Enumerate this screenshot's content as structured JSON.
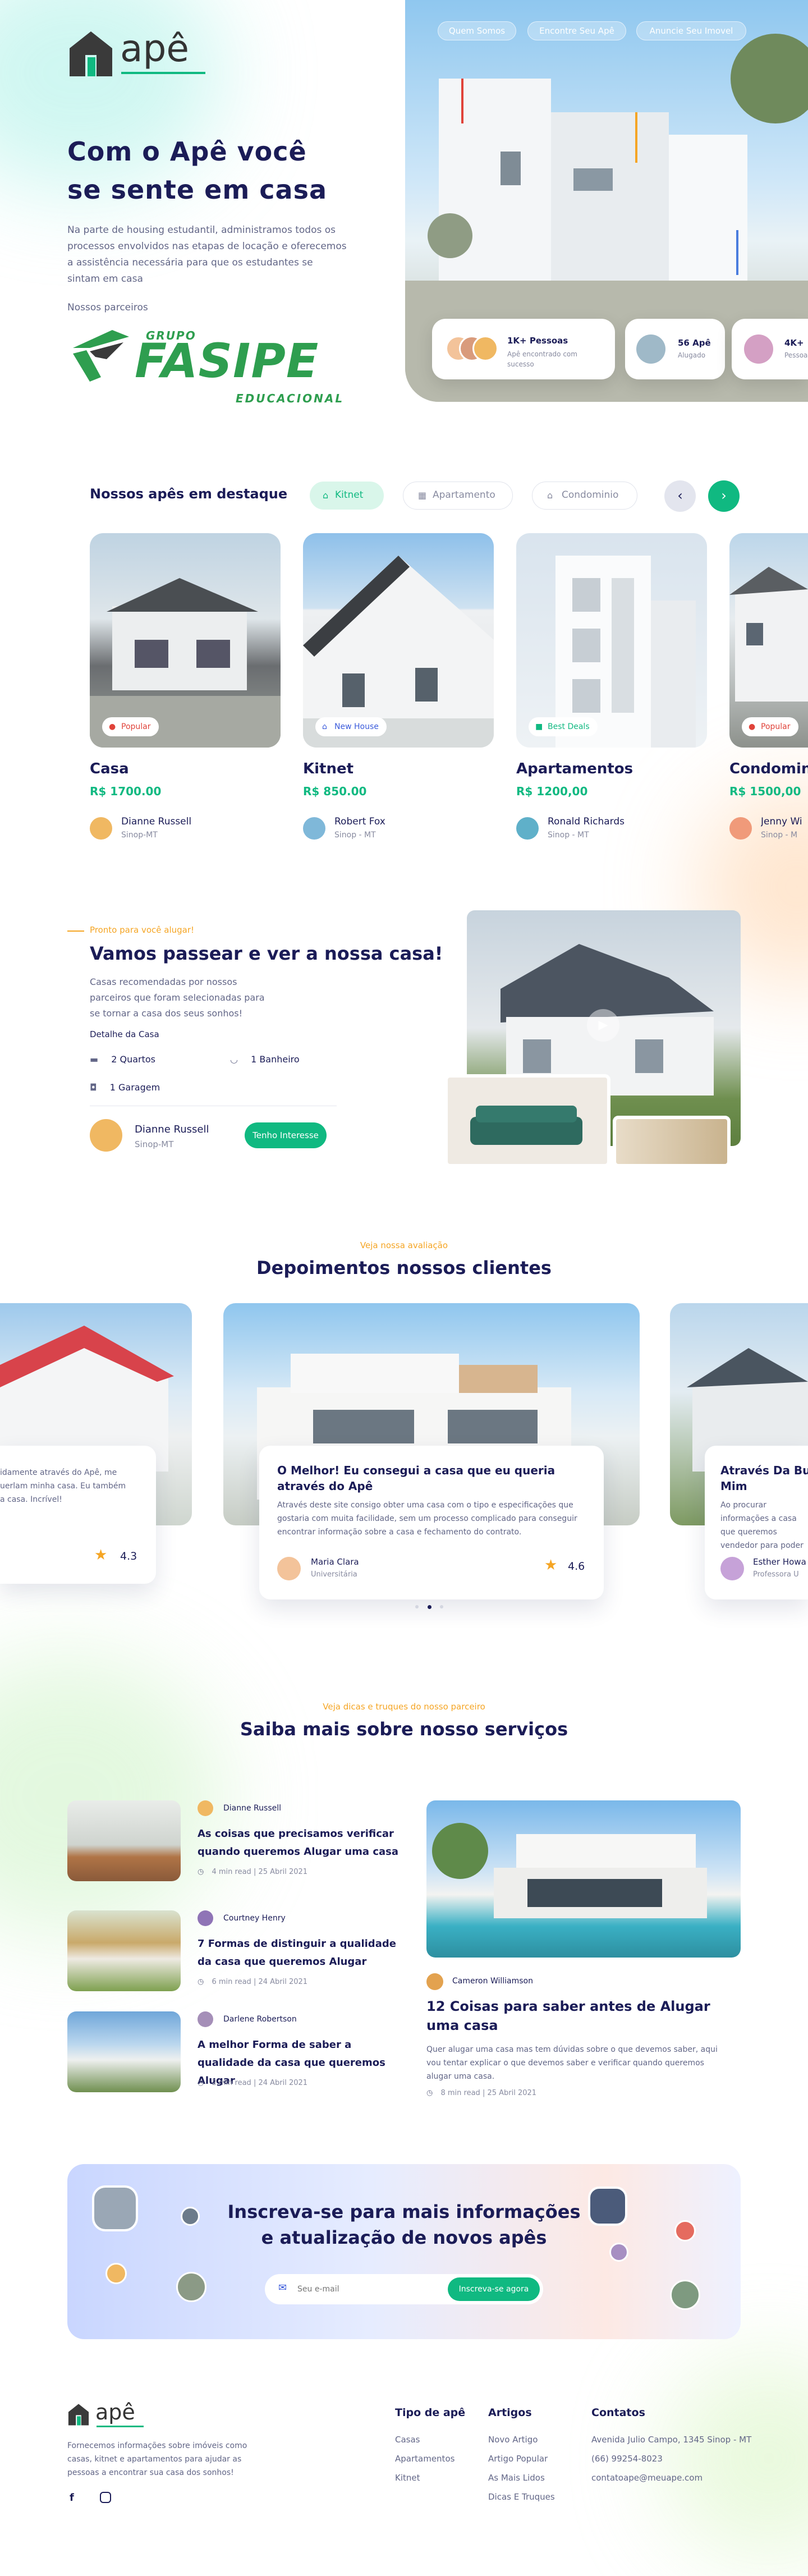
{
  "brand": {
    "name": "apê"
  },
  "nav": [
    "Quem Somos",
    "Encontre Seu Apê",
    "Anuncie Seu Imovel"
  ],
  "hero": {
    "title_line1": "Com o Apê você",
    "title_line2": "se sente em casa",
    "description": "Na parte de housing estudantil, administramos todos os processos envolvidos nas etapas de locação e oferecemos a assistência necessária para que os estudantes se sintam em casa",
    "partners_label": "Nossos parceiros",
    "partner_logo": {
      "top": "GRUPO",
      "main": "FASIPE",
      "bottom": "EDUCACIONAL"
    },
    "stats": [
      {
        "title": "1K+ Pessoas",
        "subtitle": "Apê encontrado com sucesso"
      },
      {
        "title": "56 Apê",
        "subtitle": "Alugado"
      },
      {
        "title": "4K+",
        "subtitle": "Pessoas"
      }
    ]
  },
  "featured": {
    "title": "Nossos apês em destaque",
    "tabs": [
      "Kitnet",
      "Apartamento",
      "Condominio"
    ],
    "cards": [
      {
        "badge": "Popular",
        "title": "Casa",
        "price": "R$ 1700.00",
        "owner": "Dianne Russell",
        "location": "Sinop-MT"
      },
      {
        "badge": "New House",
        "title": "Kitnet",
        "price": "R$ 850.00",
        "owner": "Robert Fox",
        "location": "Sinop - MT"
      },
      {
        "badge": "Best Deals",
        "title": "Apartamentos",
        "price": "R$ 1200,00",
        "owner": "Ronald Richards",
        "location": "Sinop - MT"
      },
      {
        "badge": "Popular",
        "title": "Condominio",
        "price": "R$ 1500,00",
        "owner": "Jenny Wi",
        "location": "Sinop - M"
      }
    ]
  },
  "visit": {
    "eyebrow": "Pronto para você alugar!",
    "title": "Vamos passear e ver a nossa casa!",
    "description": "Casas recomendadas por nossos parceiros que foram selecionadas para se tornar a casa dos seus sonhos!",
    "details_label": "Detalhe da Casa",
    "details": [
      "2 Quartos",
      "1 Banheiro",
      "1 Garagem"
    ],
    "agent_name": "Dianne Russell",
    "agent_location": "Sinop-MT",
    "cta": "Tenho Interesse"
  },
  "reviews": {
    "eyebrow": "Veja nossa avaliação",
    "title": "Depoimentos nossos clientes",
    "left_text": "idamente através do Apê, me uerlam minha casa. Eu também a casa. Incrível!",
    "left_rating": "4.3",
    "main": {
      "title": "O Melhor! Eu consegui a casa que eu queria através do Apê",
      "text": "Através deste site consigo obter uma casa com o tipo e especificações que gostaria com muita facilidade, sem um processo complicado para conseguir encontrar informação sobre a casa e fechamento do contrato.",
      "name": "Maria Clara",
      "role": "Universitária",
      "rating": "4.6"
    },
    "right": {
      "title": "Através Da Bus Mim",
      "text": "Ao procurar informações a casa que queremos vendedor para poder",
      "name": "Esther Howa",
      "role": "Professora U"
    }
  },
  "blog": {
    "eyebrow": "Veja dicas e truques do nosso parceiro",
    "title": "Saiba mais sobre nosso serviços",
    "posts": [
      {
        "author": "Dianne Russell",
        "title": "As coisas que precisamos verificar quando queremos Alugar uma casa",
        "meta": "4 min read | 25 Abril 2021"
      },
      {
        "author": "Courtney Henry",
        "title": "7 Formas de distinguir a qualidade da casa que queremos Alugar",
        "meta": "6 min read | 24 Abril 2021"
      },
      {
        "author": "Darlene Robertson",
        "title": "A melhor Forma de saber a qualidade da casa que queremos Alugar",
        "meta": "2 min read | 24 Abril 2021"
      }
    ],
    "featured": {
      "author": "Cameron Williamson",
      "title": "12 Coisas para saber antes de Alugar uma casa",
      "text": "Quer alugar uma casa mas tem dúvidas sobre o que devemos saber, aqui vou tentar explicar o que devemos saber e verificar quando queremos alugar uma casa.",
      "meta": "8 min read | 25 Abril 2021"
    }
  },
  "subscribe": {
    "title_line1": "Inscreva-se para mais informações",
    "title_line2": "e atualização de novos apês",
    "placeholder": "Seu e-mail",
    "button": "Inscreva-se agora"
  },
  "footer": {
    "description": "Fornecemos informações sobre imóveis como casas, kitnet e apartamentos para ajudar as pessoas a encontrar sua casa dos sonhos!",
    "columns": [
      {
        "title": "Tipo de apê",
        "items": [
          "Casas",
          "Apartamentos",
          "Kitnet"
        ]
      },
      {
        "title": "Artigos",
        "items": [
          "Novo Artigo",
          "Artigo Popular",
          "As Mais Lidos",
          "Dicas E Truques"
        ]
      },
      {
        "title": "Contatos",
        "items": [
          "Avenida Julio Campo, 1345 Sinop - MT",
          "(66) 99254-8023",
          "contatoape@meuape.com"
        ]
      }
    ]
  },
  "colors": {
    "navy": "#1b1c57",
    "green": "#10b981",
    "orange": "#f5a524",
    "muted": "#626687"
  }
}
